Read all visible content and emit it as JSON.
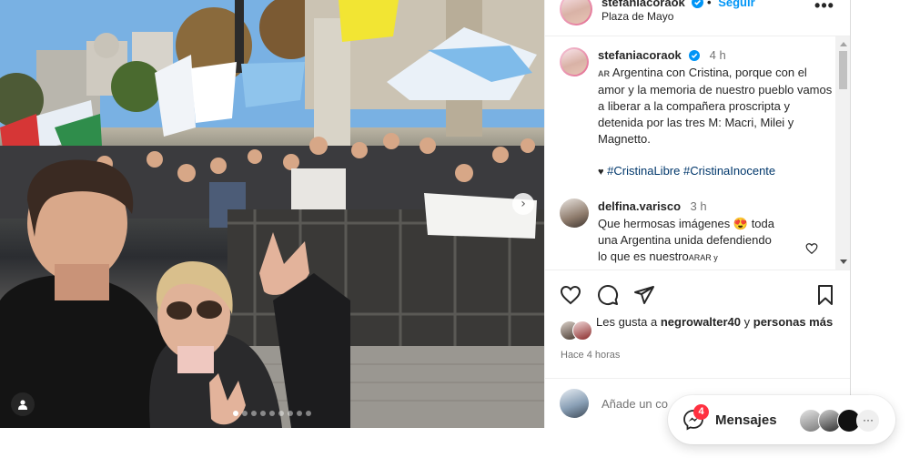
{
  "post": {
    "author": "stefaniacoraok",
    "follow_label": "Seguir",
    "location": "Plaza de Mayo",
    "more_label": "•••",
    "photo_dots": 9,
    "active_dot": 0
  },
  "caption": {
    "user": "stefaniacoraok",
    "time": "4 h",
    "flag": "AR",
    "text": "Argentina con Cristina, porque con el amor y la memoria de nuestro pueblo vamos a liberar a la compañera proscripta y detenida por las tres M: Macri, Milei y Magnetto.",
    "heart": "♥",
    "hashtags": [
      "#CristinaLibre",
      "#CristinaInocente"
    ]
  },
  "comments": [
    {
      "user": "delfina.varisco",
      "time": "3 h",
      "line1": "Que hermosas imágenes",
      "emoji": "😍",
      "line1b": "toda",
      "line2": "una Argentina unida defendiendo",
      "line3_a": "lo que es nuestro",
      "line3_flag": "AR",
      "line3_b": "AR y"
    }
  ],
  "likes": {
    "prefix": "Les gusta a",
    "user": "negrowalter40",
    "joiner": "y",
    "others": "personas más"
  },
  "timestamp": "Hace 4 horas",
  "add_comment_placeholder": "Añade un co",
  "messages": {
    "label": "Mensajes",
    "badge": "4",
    "more": "···"
  },
  "colors": {
    "accent_link": "#0095f6",
    "hashtag": "#00376b",
    "badge": "#ff3040",
    "verified": "#0095f6"
  }
}
